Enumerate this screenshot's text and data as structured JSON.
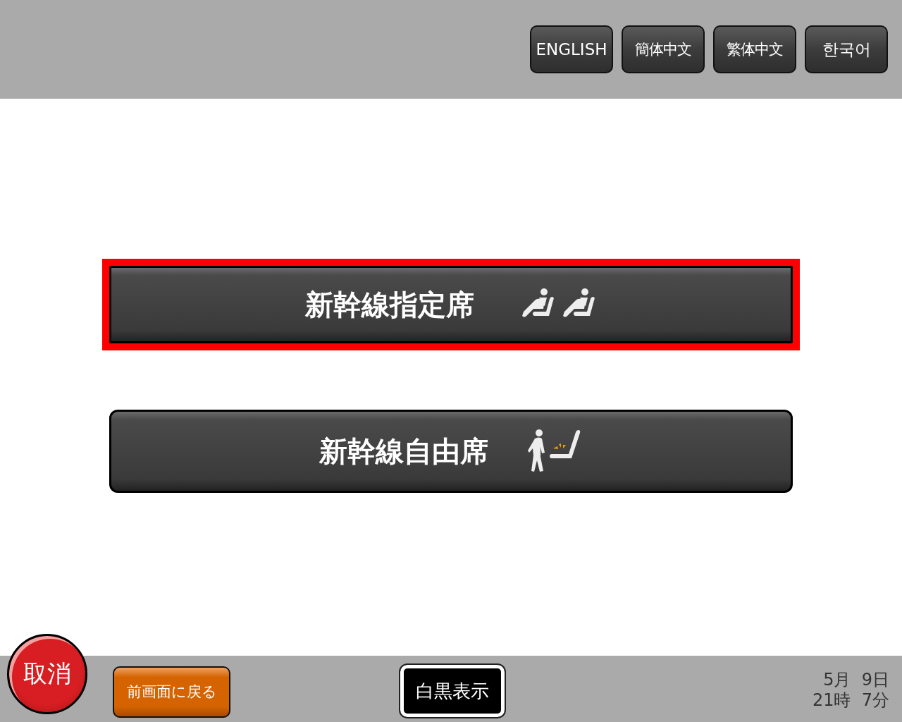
{
  "languages": [
    {
      "label": "ENGLISH"
    },
    {
      "label": "簡体中文"
    },
    {
      "label": "繁体中文"
    },
    {
      "label": "한국어"
    }
  ],
  "options": [
    {
      "label": "新幹線指定席",
      "kind": "reserved",
      "selected": true
    },
    {
      "label": "新幹線自由席",
      "kind": "unreserved",
      "selected": false
    }
  ],
  "footer": {
    "cancel": "取消",
    "back": "前画面に戻る",
    "mono": "白黒表示",
    "date": "5月  9日",
    "time": "21時  7分"
  }
}
